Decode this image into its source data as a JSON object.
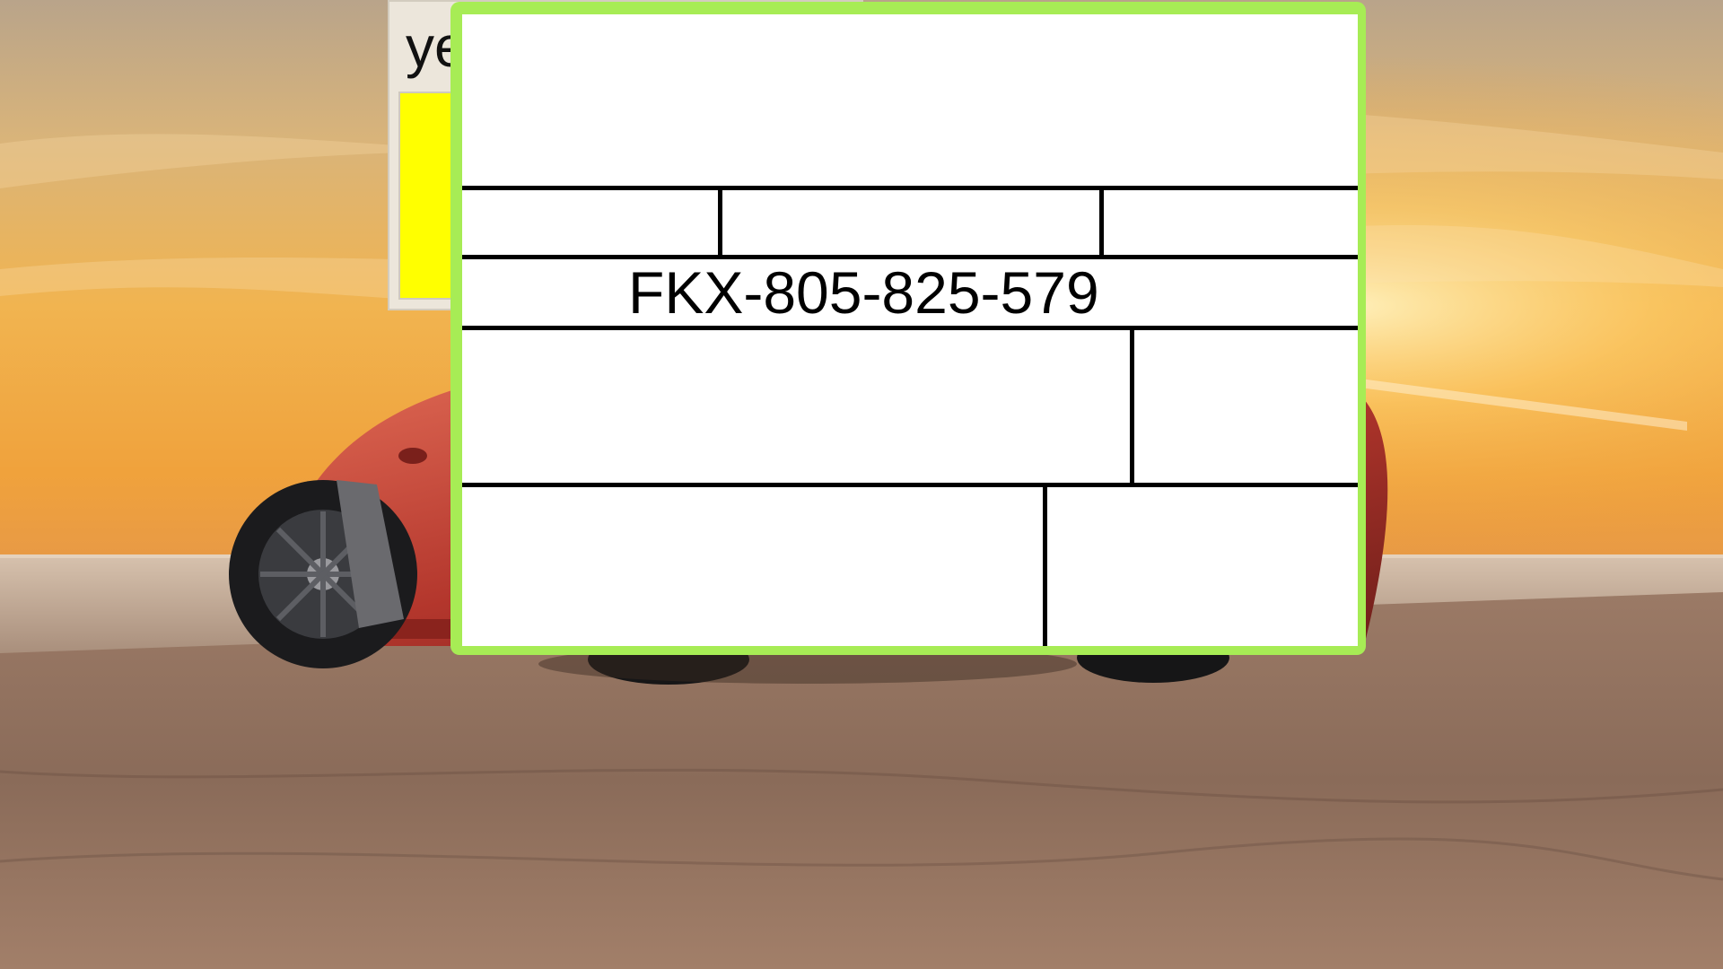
{
  "background": {
    "scene": "sunset-beach-with-red-sports-car",
    "sky_color": "#f2b24a",
    "sea_color": "#b49a86",
    "sand_color": "#8a6a58"
  },
  "back_window": {
    "title_visible": "ye",
    "panel_color": "#ffff00"
  },
  "form": {
    "border_color": "#a7ec55",
    "code": "FKX-805-825-579"
  }
}
